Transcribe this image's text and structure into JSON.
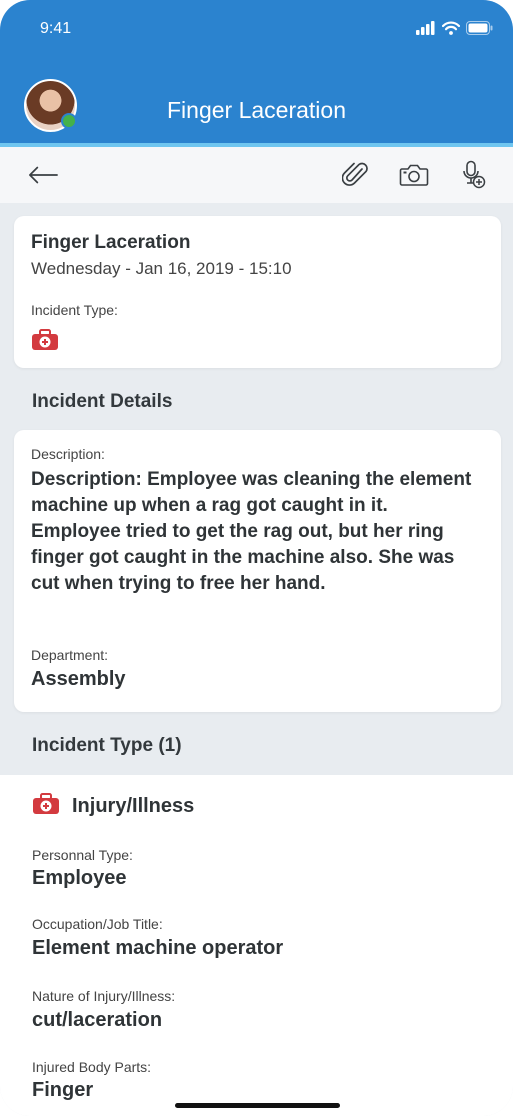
{
  "status_bar": {
    "time": "9:41"
  },
  "header": {
    "title": "Finger Laceration"
  },
  "toolbar": {
    "back_icon": "arrow-left-icon",
    "attach_icon": "paperclip-icon",
    "camera_icon": "camera-icon",
    "mic_icon": "microphone-add-icon"
  },
  "summary_card": {
    "title": "Finger Laceration",
    "date": "Wednesday - Jan 16, 2019  - 15:10",
    "incident_type_label": "Incident Type:",
    "incident_type_icon": "medical-kit-icon"
  },
  "incident_details": {
    "heading": "Incident Details",
    "description_label": "Description:",
    "description_text": "Description: Employee was cleaning the element machine up when a rag got caught in it. Employee tried to get the rag out, but her ring finger got caught in the machine also. She was cut when trying to free her hand.",
    "department_label": "Department:",
    "department_value": "Assembly"
  },
  "incident_type_section": {
    "heading": "Incident Type (1)",
    "type_label": "Injury/Illness",
    "fields": [
      {
        "label": "Personnal Type:",
        "value": "Employee"
      },
      {
        "label": "Occupation/Job Title:",
        "value": "Element machine operator"
      },
      {
        "label": "Nature of Injury/Illness:",
        "value": "cut/laceration"
      },
      {
        "label": "Injured  Body Parts:",
        "value": "Finger"
      }
    ]
  },
  "colors": {
    "header_blue": "#2b83cf",
    "stripe_blue": "#6fc6f0",
    "background_gray": "#e8ecf0",
    "medical_red": "#d33a3f"
  }
}
